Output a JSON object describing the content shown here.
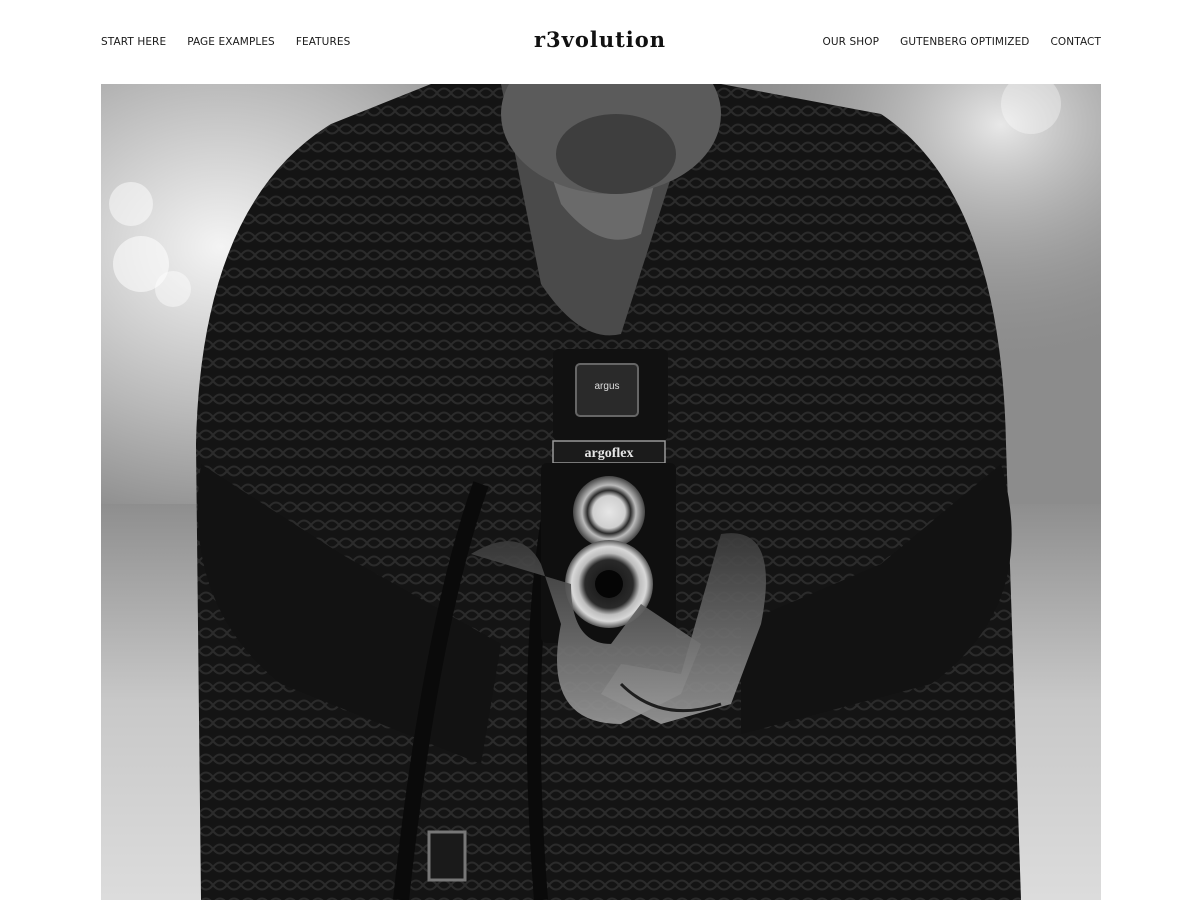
{
  "site": {
    "logo": "r3volution"
  },
  "nav_left": [
    {
      "label": "START HERE"
    },
    {
      "label": "PAGE EXAMPLES"
    },
    {
      "label": "FEATURES"
    }
  ],
  "nav_right": [
    {
      "label": "OUR SHOP"
    },
    {
      "label": "GUTENBERG OPTIMIZED"
    },
    {
      "label": "CONTACT"
    }
  ],
  "hero": {
    "camera_badge": "argus",
    "camera_brand": "argoflex"
  }
}
